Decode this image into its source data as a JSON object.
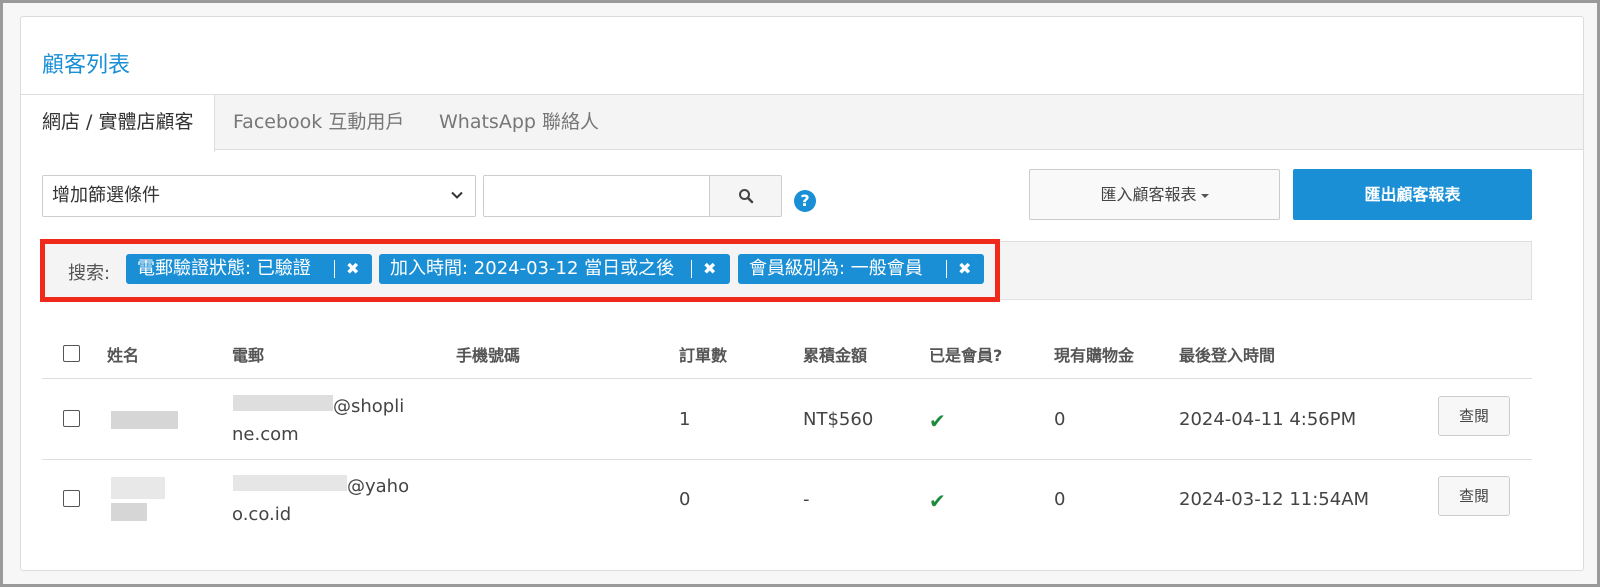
{
  "page": {
    "title": "顧客列表"
  },
  "tabs": [
    {
      "label": "網店 / 實體店顧客",
      "active": true
    },
    {
      "label": "Facebook 互動用戶",
      "active": false
    },
    {
      "label": "WhatsApp 聯絡人",
      "active": false
    }
  ],
  "toolbar": {
    "filter_select_value": "增加篩選條件",
    "search_value": "",
    "help_symbol": "?",
    "import_label": "匯入顧客報表",
    "export_label": "匯出顧客報表"
  },
  "search": {
    "label": "搜索:",
    "chips": [
      {
        "text": "電郵驗證狀態: 已驗證",
        "remove": "✖"
      },
      {
        "text": "加入時間: 2024-03-12 當日或之後",
        "remove": "✖"
      },
      {
        "text": "會員級別為: 一般會員",
        "remove": "✖"
      }
    ]
  },
  "table": {
    "headers": [
      "姓名",
      "電郵",
      "手機號碼",
      "訂單數",
      "累積金額",
      "已是會員?",
      "現有購物金",
      "最後登入時間"
    ],
    "rows": [
      {
        "email_line1": "@shopli",
        "email_line2": "ne.com",
        "phone": "",
        "orders": "1",
        "amount": "NT$560",
        "is_member": "✔",
        "credit": "0",
        "last_login": "2024-04-11 4:56PM",
        "action": "查閱"
      },
      {
        "email_line1": "@yaho",
        "email_line2": "o.co.id",
        "phone": "",
        "orders": "0",
        "amount": "-",
        "is_member": "✔",
        "credit": "0",
        "last_login": "2024-03-12 11:54AM",
        "action": "查閱"
      }
    ]
  },
  "colors": {
    "accent": "#1a8fd6",
    "highlight_border": "#f02a1a",
    "check": "#1e8b3a"
  }
}
